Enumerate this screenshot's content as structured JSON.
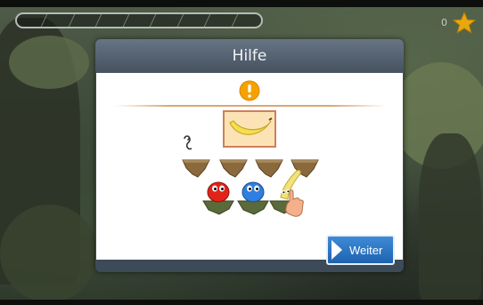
{
  "hud": {
    "progress_segments": 9,
    "progress_value": 0,
    "score": "0"
  },
  "dialog": {
    "title": "Hilfe",
    "continue_label": "Weiter"
  },
  "icons": {
    "alert": "exclamation-icon",
    "star": "star-icon",
    "ear": "ear-icon",
    "continue": "play-arrow-icon"
  },
  "colors": {
    "accent_blue": "#2a74c6",
    "alert_orange": "#f5a100",
    "star_gold": "#e8a70f"
  }
}
